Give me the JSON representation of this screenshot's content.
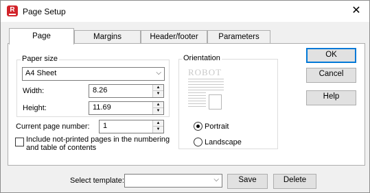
{
  "window": {
    "title": "Page Setup",
    "app_icon": "R",
    "close": "✕"
  },
  "tabs": [
    "Page",
    "Margins",
    "Header/footer",
    "Parameters"
  ],
  "paper_size": {
    "group_label": "Paper size",
    "selected": "A4 Sheet",
    "width_label": "Width:",
    "width_value": "8.26",
    "height_label": "Height:",
    "height_value": "11.69"
  },
  "page_number": {
    "label": "Current page number:",
    "value": "1"
  },
  "include_nonprinted": {
    "line1": "Include not-printed pages in the numbering",
    "line2": "and table of contents",
    "checked": false
  },
  "orientation": {
    "group_label": "Orientation",
    "preview_word": "ROBOT",
    "portrait_label": "Portrait",
    "landscape_label": "Landscape",
    "selected": "portrait"
  },
  "buttons": {
    "ok": "OK",
    "cancel": "Cancel",
    "help": "Help",
    "save": "Save",
    "delete": "Delete"
  },
  "template": {
    "label": "Select template:",
    "value": ""
  },
  "icons": {
    "chevron": "chevron-down-icon",
    "spin": "spin-arrows-icon"
  },
  "colors": {
    "app_icon": "#d2232a",
    "default_button_border": "#0078d7"
  }
}
